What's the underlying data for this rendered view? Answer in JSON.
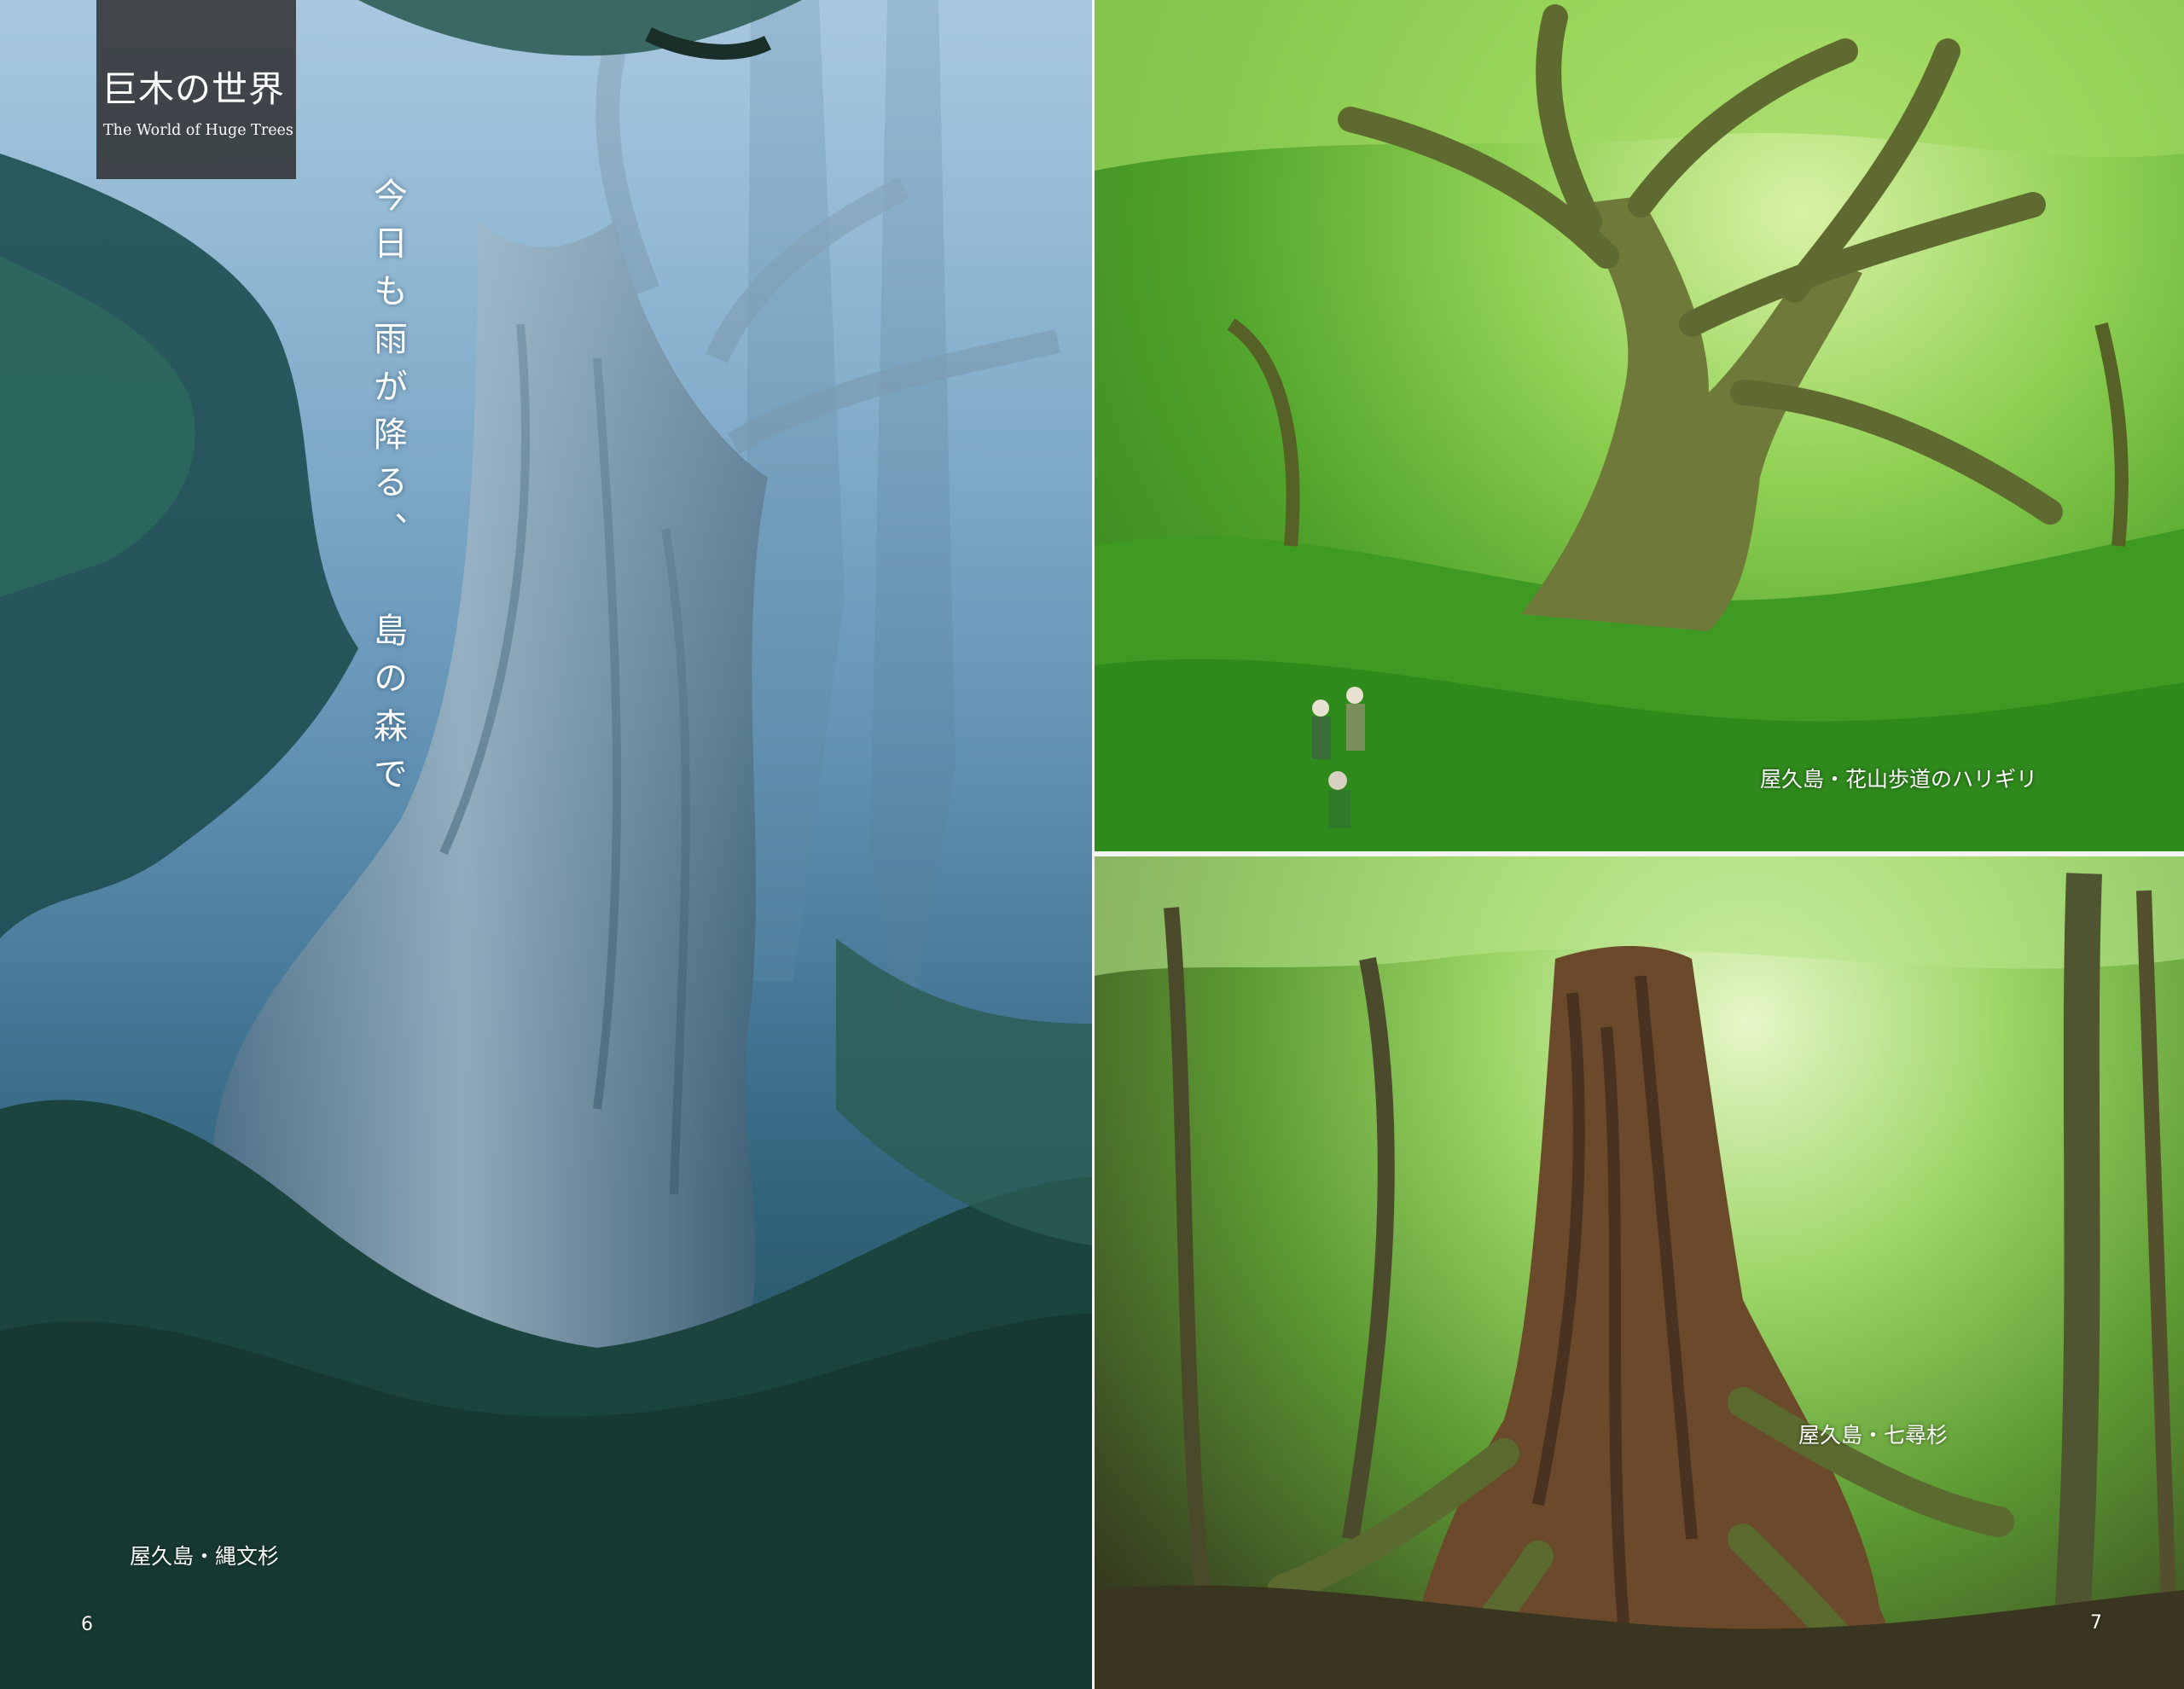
{
  "header": {
    "title_jp": "巨木の世界",
    "title_en": "The World of Huge Trees"
  },
  "left_page": {
    "headline": "今日も雨が降る、 島の森で",
    "caption": "屋久島・縄文杉",
    "page_number": "6"
  },
  "right_page": {
    "top_photo_caption": "屋久島・花山歩道のハリギリ",
    "bottom_photo_caption": "屋久島・七尋杉",
    "page_number": "7"
  },
  "colors": {
    "mist_blue": "#5f8fb2",
    "forest_green": "#4fa22a",
    "title_box": "#282828",
    "text": "#ffffff"
  }
}
